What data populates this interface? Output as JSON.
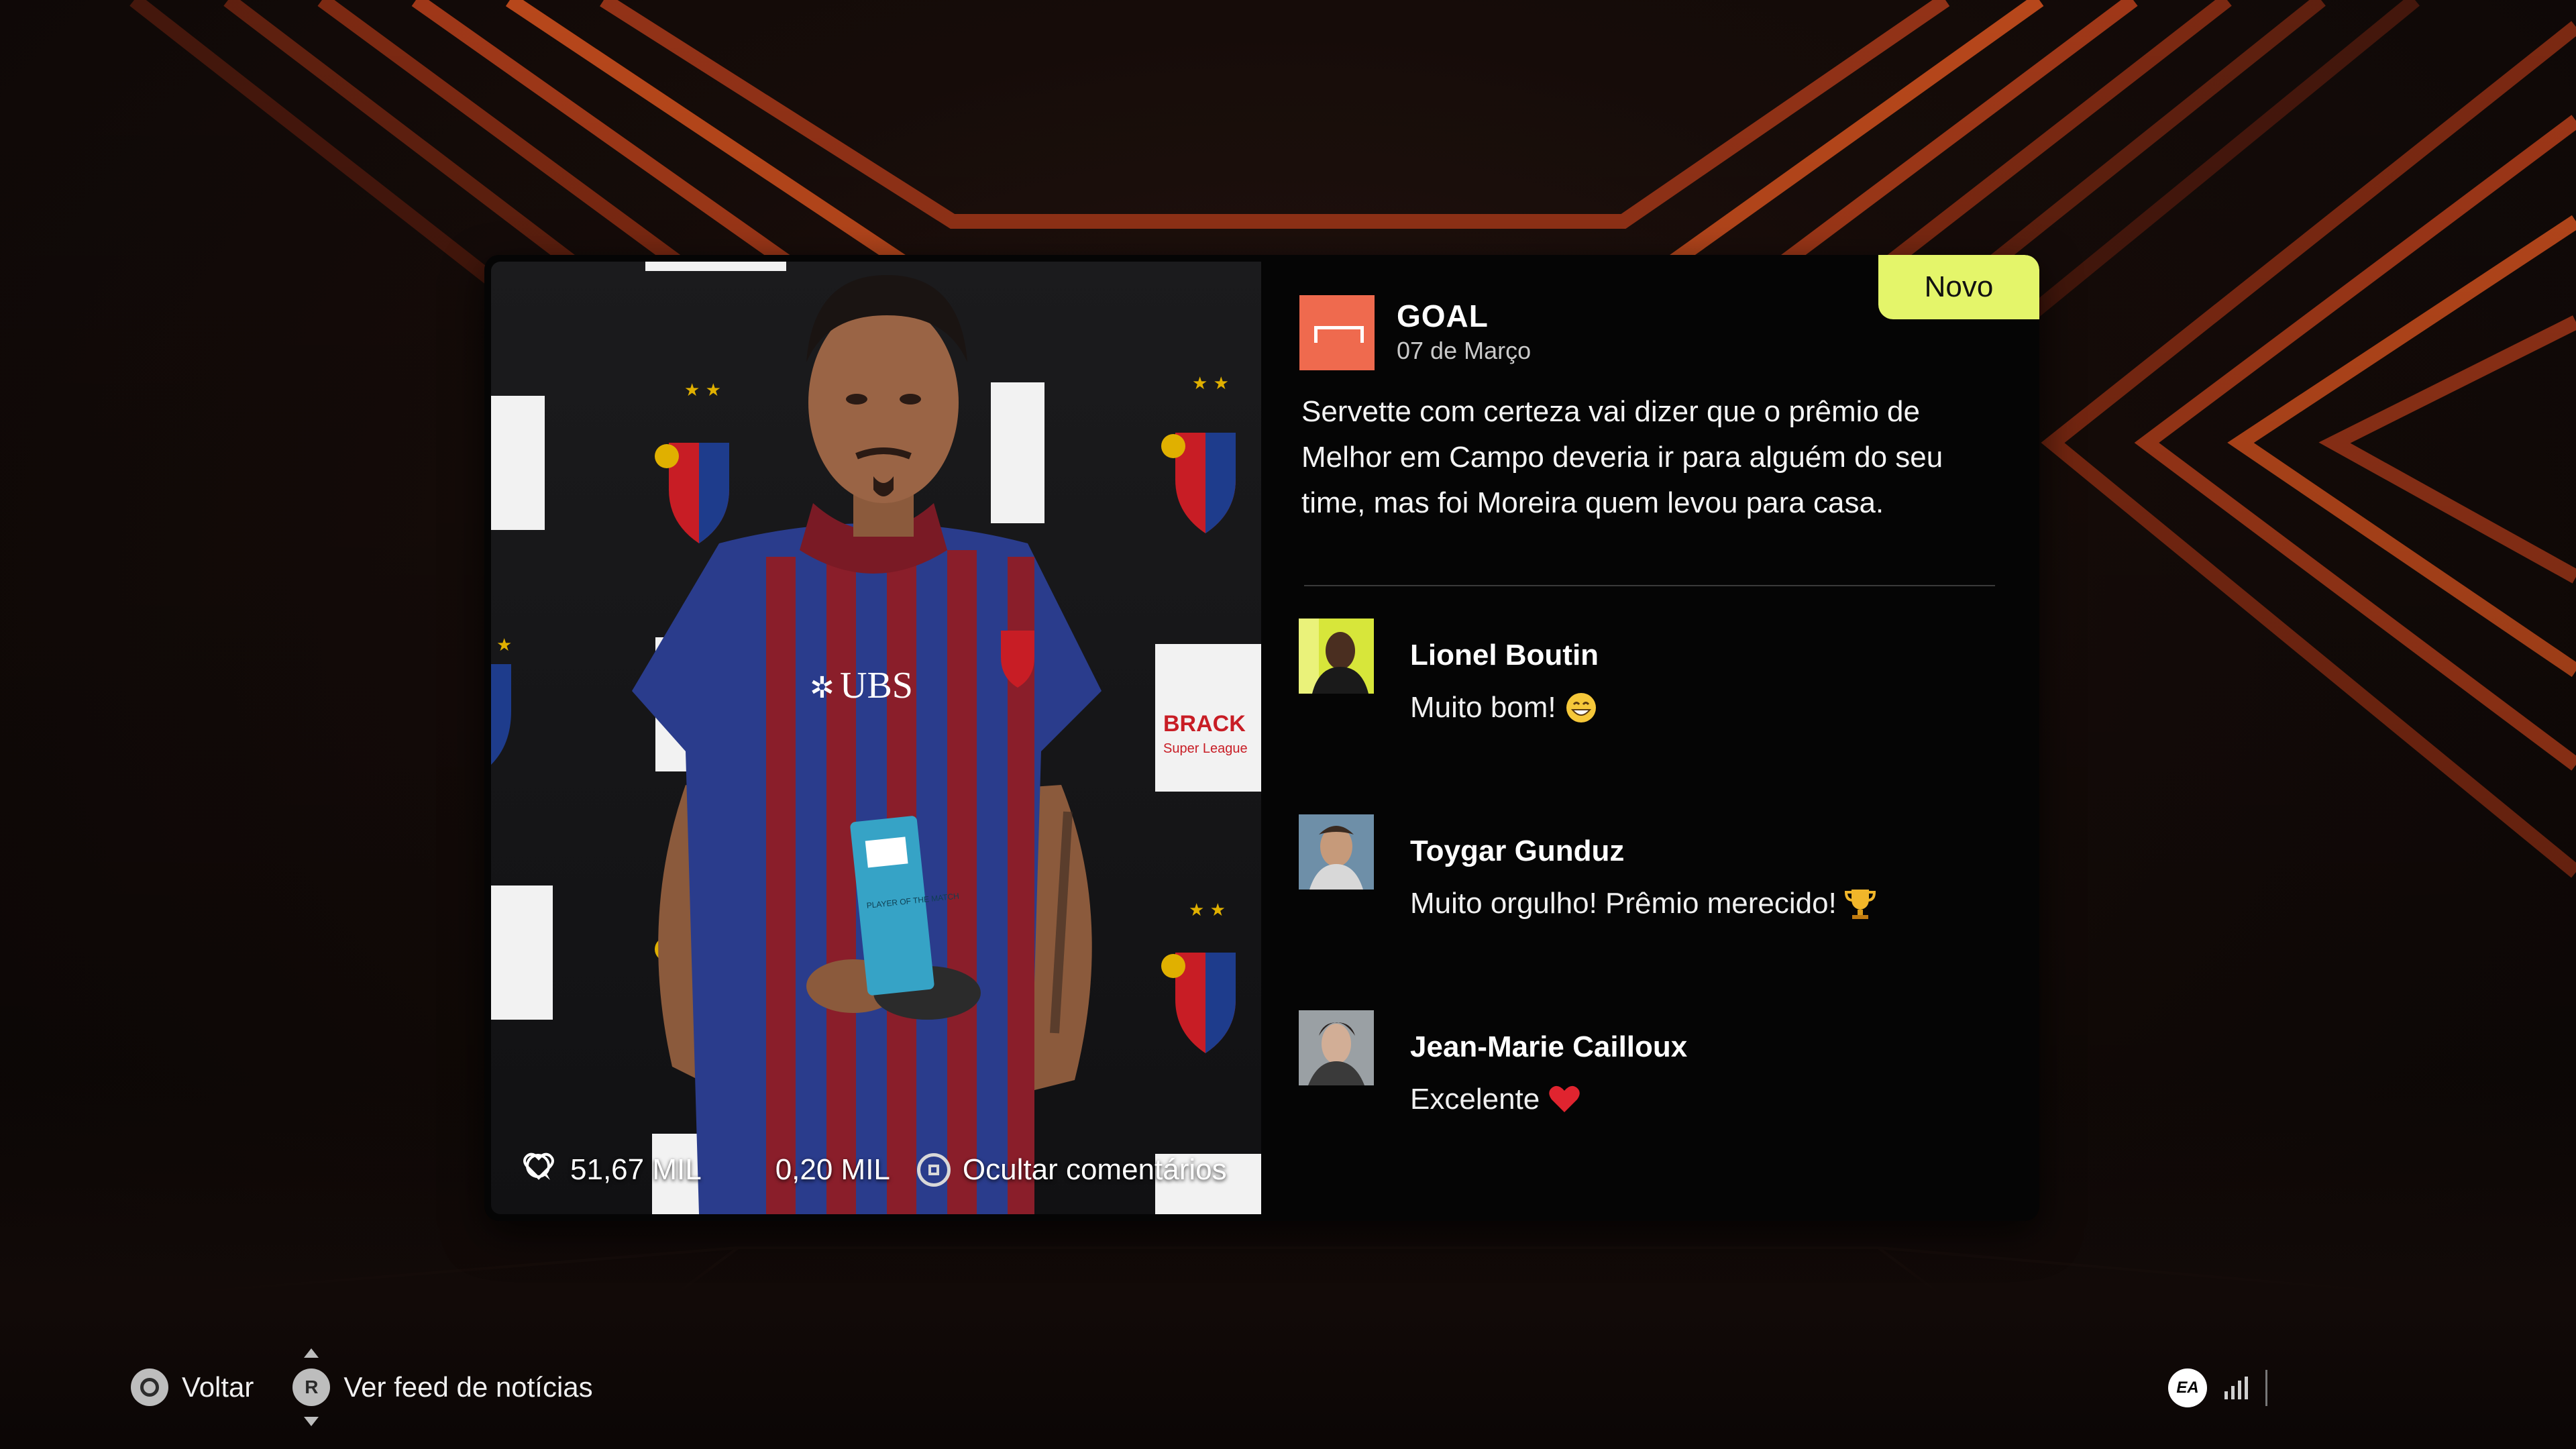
{
  "post": {
    "badge": "Novo",
    "source_name": "GOAL",
    "source_icon": "goal-icon",
    "date": "07 de Março",
    "text": "Servette com certeza vai dizer que o prêmio de Melhor em Campo deveria ir para alguém do seu time, mas foi Moreira quem levou para casa.",
    "likes": "51,67 MIL",
    "comments_count": "0,20 MIL",
    "toggle_comments_label": "Ocultar comentários",
    "image_texts": {
      "sponsor": "UBS",
      "board": "BRACK",
      "board_sub": "Super League",
      "trophy": "PLAYER OF THE MATCH"
    }
  },
  "comments": [
    {
      "name": "Lionel Boutin",
      "text": "Muito bom!",
      "emoji": "grinning-face-icon"
    },
    {
      "name": "Toygar Gunduz",
      "text": "Muito orgulho! Prêmio merecido!",
      "emoji": "trophy-icon"
    },
    {
      "name": "Jean-Marie Cailloux",
      "text": "Excelente",
      "emoji": "red-heart-icon"
    }
  ],
  "footer": {
    "back_label": "Voltar",
    "feed_label": "Ver feed de notícias",
    "r_key": "R"
  },
  "system": {
    "ea_logo": "EA"
  },
  "colors": {
    "accent_badge": "#e4f56a",
    "source_logo": "#ef6a4e",
    "background_stripes": "#c8401a"
  }
}
